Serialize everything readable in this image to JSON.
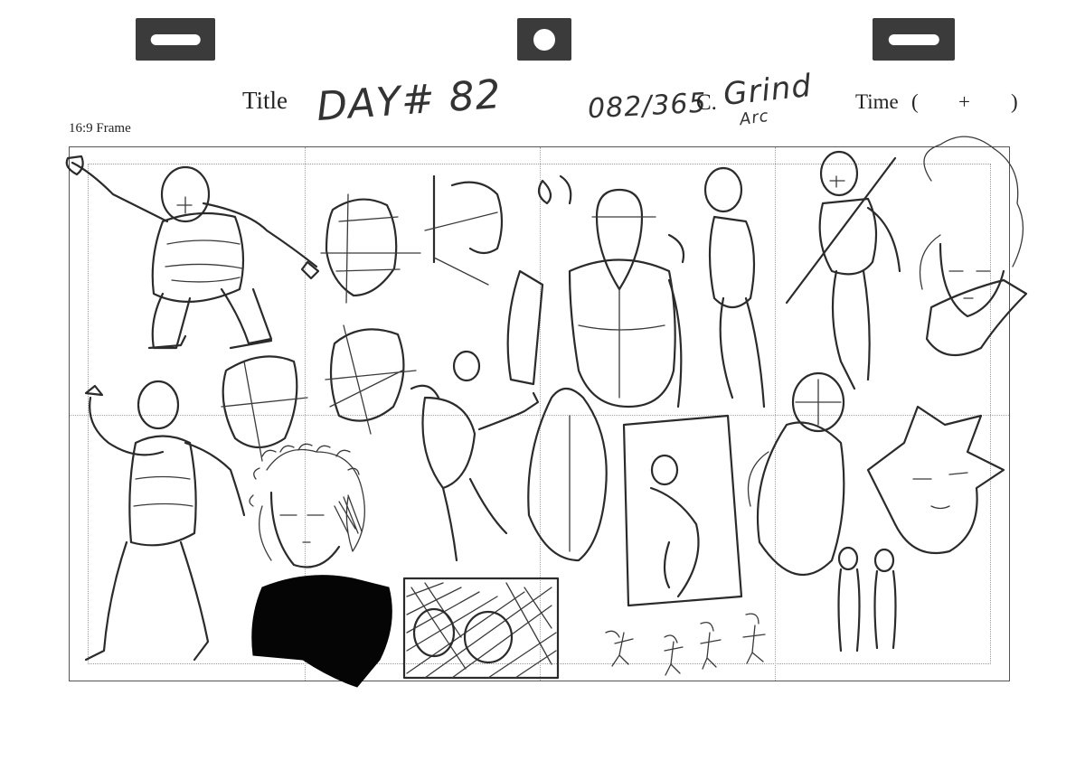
{
  "header": {
    "title_label": "Title",
    "title_value": "DAY# 82",
    "count_value": "082/365",
    "cut_label": "C.",
    "cut_value": "Grind",
    "cut_value_sub": "Arc",
    "time_label": "Time",
    "time_open": "(",
    "time_plus": "+",
    "time_close": ")"
  },
  "frame": {
    "label": "16:9 Frame"
  },
  "sketches": [
    "figure-leaping",
    "head-construction-boxes",
    "face-profile",
    "torso-front",
    "figure-standing",
    "figure-with-staff",
    "curly-hair-face-portrait",
    "mannequin-figure-walking",
    "head-box-study",
    "boxing-kick-figure",
    "back-torso-study",
    "crouching-figure-panel",
    "figure-with-helmet",
    "spiky-hair-face",
    "shaded-portrait-black-shirt",
    "crosshatched-thumbnail",
    "small-gesture-figures",
    "small-standing-figures"
  ]
}
